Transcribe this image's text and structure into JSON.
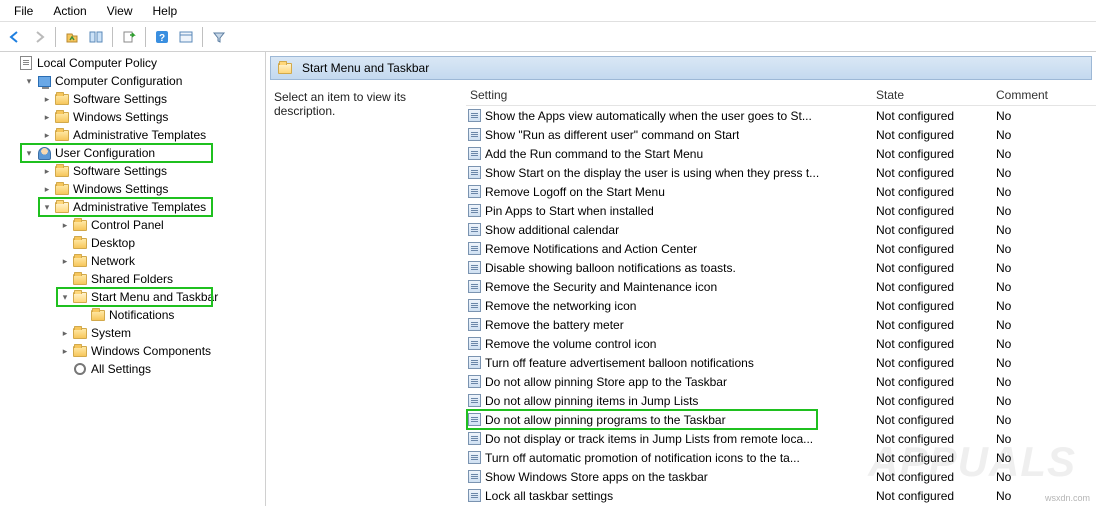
{
  "menu": {
    "file": "File",
    "action": "Action",
    "view": "View",
    "help": "Help"
  },
  "toolbar_icons": {
    "back": "back-icon",
    "forward": "forward-icon",
    "up": "up-icon",
    "show": "show-icon",
    "refresh": "refresh-icon",
    "export": "export-icon",
    "help": "help-icon",
    "props": "properties-icon",
    "filter": "filter-icon"
  },
  "tree": [
    {
      "indent": 0,
      "exp": "",
      "icon": "policy",
      "label": "Local Computer Policy"
    },
    {
      "indent": 1,
      "exp": "▾",
      "icon": "comp",
      "label": "Computer Configuration"
    },
    {
      "indent": 2,
      "exp": ">",
      "icon": "folder",
      "label": "Software Settings"
    },
    {
      "indent": 2,
      "exp": ">",
      "icon": "folder",
      "label": "Windows Settings"
    },
    {
      "indent": 2,
      "exp": ">",
      "icon": "folder",
      "label": "Administrative Templates"
    },
    {
      "indent": 1,
      "exp": "▾",
      "icon": "user",
      "label": "User Configuration",
      "hl": true
    },
    {
      "indent": 2,
      "exp": ">",
      "icon": "folder",
      "label": "Software Settings"
    },
    {
      "indent": 2,
      "exp": ">",
      "icon": "folder",
      "label": "Windows Settings"
    },
    {
      "indent": 2,
      "exp": "▾",
      "icon": "folder-open",
      "label": "Administrative Templates",
      "hl": true
    },
    {
      "indent": 3,
      "exp": ">",
      "icon": "folder",
      "label": "Control Panel"
    },
    {
      "indent": 3,
      "exp": "",
      "icon": "folder",
      "label": "Desktop"
    },
    {
      "indent": 3,
      "exp": ">",
      "icon": "folder",
      "label": "Network"
    },
    {
      "indent": 3,
      "exp": "",
      "icon": "folder",
      "label": "Shared Folders"
    },
    {
      "indent": 3,
      "exp": "▾",
      "icon": "folder-open",
      "label": "Start Menu and Taskbar",
      "hl": true
    },
    {
      "indent": 4,
      "exp": "",
      "icon": "folder",
      "label": "Notifications",
      "hl_connect": true
    },
    {
      "indent": 3,
      "exp": ">",
      "icon": "folder",
      "label": "System"
    },
    {
      "indent": 3,
      "exp": ">",
      "icon": "folder",
      "label": "Windows Components"
    },
    {
      "indent": 3,
      "exp": "",
      "icon": "gear",
      "label": "All Settings"
    }
  ],
  "header_title": "Start Menu and Taskbar",
  "description_hint": "Select an item to view its description.",
  "columns": {
    "setting": "Setting",
    "state": "State",
    "comment": "Comment"
  },
  "settings": [
    {
      "name": "Show the Apps view automatically when the user goes to St...",
      "state": "Not configured",
      "comment": "No"
    },
    {
      "name": "Show \"Run as different user\" command on Start",
      "state": "Not configured",
      "comment": "No"
    },
    {
      "name": "Add the Run command to the Start Menu",
      "state": "Not configured",
      "comment": "No"
    },
    {
      "name": "Show Start on the display the user is using when they press t...",
      "state": "Not configured",
      "comment": "No"
    },
    {
      "name": "Remove Logoff on the Start Menu",
      "state": "Not configured",
      "comment": "No"
    },
    {
      "name": "Pin Apps to Start when installed",
      "state": "Not configured",
      "comment": "No"
    },
    {
      "name": "Show additional calendar",
      "state": "Not configured",
      "comment": "No"
    },
    {
      "name": "Remove Notifications and Action Center",
      "state": "Not configured",
      "comment": "No"
    },
    {
      "name": "Disable showing balloon notifications as toasts.",
      "state": "Not configured",
      "comment": "No"
    },
    {
      "name": "Remove the Security and Maintenance icon",
      "state": "Not configured",
      "comment": "No"
    },
    {
      "name": "Remove the networking icon",
      "state": "Not configured",
      "comment": "No"
    },
    {
      "name": "Remove the battery meter",
      "state": "Not configured",
      "comment": "No"
    },
    {
      "name": "Remove the volume control icon",
      "state": "Not configured",
      "comment": "No"
    },
    {
      "name": "Turn off feature advertisement balloon notifications",
      "state": "Not configured",
      "comment": "No"
    },
    {
      "name": "Do not allow pinning Store app to the Taskbar",
      "state": "Not configured",
      "comment": "No"
    },
    {
      "name": "Do not allow pinning items in Jump Lists",
      "state": "Not configured",
      "comment": "No"
    },
    {
      "name": "Do not allow pinning programs to the Taskbar",
      "state": "Not configured",
      "comment": "No",
      "hl": true
    },
    {
      "name": "Do not display or track items in Jump Lists from remote loca...",
      "state": "Not configured",
      "comment": "No"
    },
    {
      "name": "Turn off automatic promotion of notification icons to the ta...",
      "state": "Not configured",
      "comment": "No"
    },
    {
      "name": "Show Windows Store apps on the taskbar",
      "state": "Not configured",
      "comment": "No"
    },
    {
      "name": "Lock all taskbar settings",
      "state": "Not configured",
      "comment": "No"
    }
  ],
  "watermark_small": "wsxdn.com",
  "watermark_big": "APPUALS"
}
